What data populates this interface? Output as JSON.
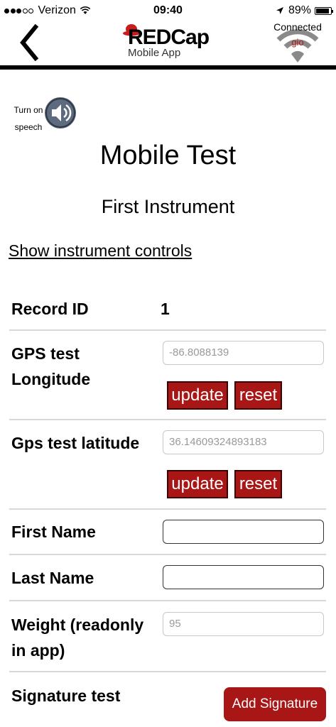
{
  "status_bar": {
    "carrier": "Verizon",
    "time": "09:40",
    "battery": "89%",
    "battery_level": 0.89
  },
  "nav": {
    "logo_text": "REDCap",
    "logo_subtitle": "Mobile App",
    "connection_status": "Connected",
    "connection_user": "gio"
  },
  "speech": {
    "label_line1": "Turn on",
    "label_line2": "speech"
  },
  "form": {
    "title": "Mobile Test",
    "instrument": "First Instrument",
    "show_controls": "Show instrument controls",
    "record_id_label": "Record ID",
    "record_id_value": "1",
    "gps_longitude_label_line1": "GPS test",
    "gps_longitude_label_line2": "Longitude",
    "gps_longitude_value": "-86.8088139",
    "gps_latitude_label": "Gps test latitude",
    "gps_latitude_value": "36.14609324893183",
    "update_label": "update",
    "reset_label": "reset",
    "first_name_label": "First Name",
    "first_name_value": "",
    "last_name_label": "Last Name",
    "last_name_value": "",
    "weight_label_line1": "Weight (readonly",
    "weight_label_line2": "in app)",
    "weight_value": "95",
    "signature_label": "Signature test",
    "add_signature_label": "Add Signature"
  },
  "colors": {
    "accent_red": "#a91616",
    "connection_user": "#b01818"
  }
}
